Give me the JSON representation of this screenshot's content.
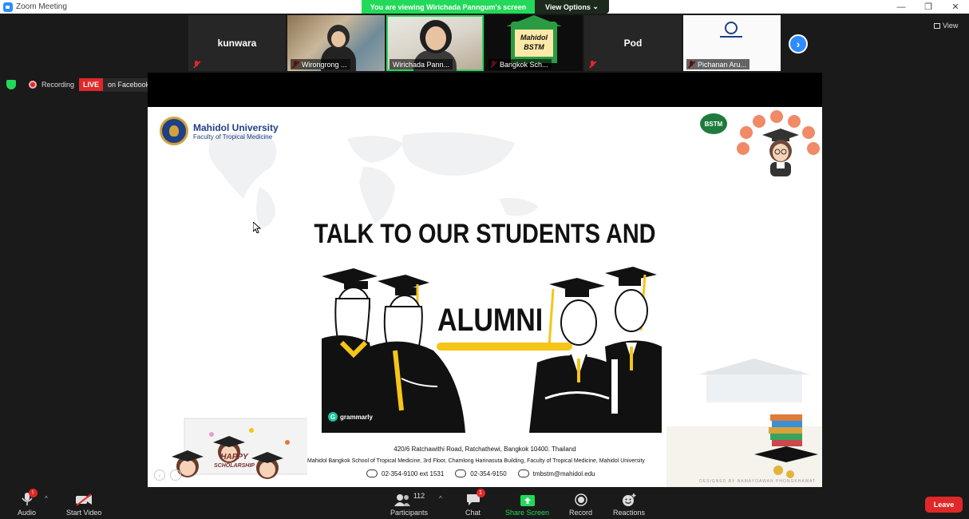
{
  "window": {
    "title": "Zoom Meeting",
    "minimize": "—",
    "restore": "❐",
    "close": "✕"
  },
  "banner": {
    "message": "You are viewing Wirichada Panngum's screen",
    "options_label": "View Options"
  },
  "gallery": {
    "tiles": [
      {
        "name": "kunwara",
        "label": ""
      },
      {
        "name": "",
        "label": "Wirongrong ..."
      },
      {
        "name": "",
        "label": "Wirichada Pann..."
      },
      {
        "name": "",
        "label": "Bangkok Sch..."
      },
      {
        "name": "Pod",
        "label": ""
      },
      {
        "name": "",
        "label": "Pichanan Aru..."
      }
    ],
    "bstm_tile_text": "Mahidol\nBSTM",
    "next_arrow": "›",
    "view_label": "View"
  },
  "recording": {
    "status": "Recording",
    "live": "LIVE",
    "destination": "on Facebook"
  },
  "slide": {
    "university": "Mahidol University",
    "faculty": "Faculty of Tropical Medicine",
    "bstm_badge": "BSTM",
    "headline": "TALK TO OUR STUDENTS AND",
    "alumni": "ALUMNI",
    "grammarly": "grammarly",
    "address1": "420/6 Ratchawithi Road, Ratchathewi, Bangkok 10400. Thailand",
    "address2": "Mahidol Bangkok School of Tropical Medicine, 3rd Floor, Chamlong Harinasuta Building, Faculty of Tropical Medicine, Mahidol University",
    "phone": "02-354-9100 ext 1531",
    "fax": "02-354-9150",
    "email": "tmbstm@mahidol.edu",
    "scholarship_line1": "HAPPY",
    "scholarship_line2": "SCHOLARSHIP",
    "credit": "DESIGNED BY NAMAYOAWAN PHONGKHAWAT"
  },
  "toolbar": {
    "audio": "Audio",
    "audio_badge": "!",
    "start_video": "Start Video",
    "participants": "Participants",
    "participants_count": "112",
    "chat": "Chat",
    "chat_badge": "1",
    "share_screen": "Share Screen",
    "record": "Record",
    "reactions": "Reactions",
    "leave": "Leave"
  },
  "colors": {
    "zoom_blue": "#2d8cff",
    "share_green": "#23d959",
    "leave_red": "#e02828",
    "mahidol_blue": "#1f3f86",
    "alumni_yellow": "#f5c518"
  }
}
